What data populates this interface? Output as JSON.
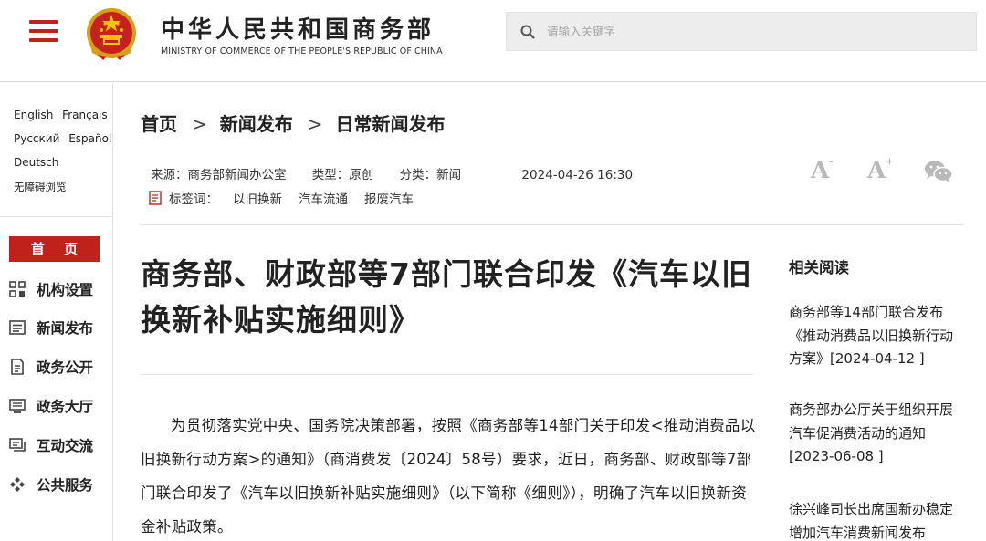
{
  "header": {
    "site_title": "中华人民共和国商务部",
    "site_subtitle": "MINISTRY OF COMMERCE OF THE PEOPLE'S REPUBLIC OF CHINA",
    "search_placeholder": "请输入关键字",
    "brand_color": "#c0211b"
  },
  "sidebar": {
    "languages": [
      "English",
      "Français",
      "Русский",
      "Español",
      "Deutsch"
    ],
    "accessibility": "无障碍浏览",
    "home_label": "首 页",
    "nav_items": [
      {
        "label": "机构设置",
        "icon": "org-structure-icon"
      },
      {
        "label": "新闻发布",
        "icon": "news-list-icon"
      },
      {
        "label": "政务公开",
        "icon": "document-icon"
      },
      {
        "label": "政务大厅",
        "icon": "service-hall-icon"
      },
      {
        "label": "互动交流",
        "icon": "chat-icon"
      },
      {
        "label": "公共服务",
        "icon": "service-diamond-icon"
      }
    ]
  },
  "breadcrumb": [
    "首页",
    "新闻发布",
    "日常新闻发布"
  ],
  "meta": {
    "source": "来源：商务部新闻办公室",
    "type": "类型：原创",
    "category": "分类：新闻",
    "datetime": "2024-04-26 16:30",
    "tags_label": "标签词：",
    "tags": [
      "以旧换新",
      "汽车流通",
      "报废汽车"
    ]
  },
  "tools": {
    "font_decrease": "A",
    "font_increase": "A",
    "share_icon": "wechat-icon"
  },
  "article": {
    "title": "商务部、财政部等7部门联合印发《汽车以旧换新补贴实施细则》",
    "body": "为贯彻落实党中央、国务院决策部署，按照《商务部等14部门关于印发<推动消费品以旧换新行动方案>的通知》（商消费发〔2024〕58号）要求，近日，商务部、财政部等7部门联合印发了《汽车以旧换新补贴实施细则》（以下简称《细则》），明确了汽车以旧换新资金补贴政策。"
  },
  "related": {
    "title": "相关阅读",
    "items": [
      "商务部等14部门联合发布《推动消费品以旧换新行动方案》[2024-04-12 ]",
      "商务部办公厅关于组织开展汽车促消费活动的通知[2023-06-08 ]",
      "徐兴峰司长出席国新办稳定增加汽车消费新闻发布"
    ]
  }
}
